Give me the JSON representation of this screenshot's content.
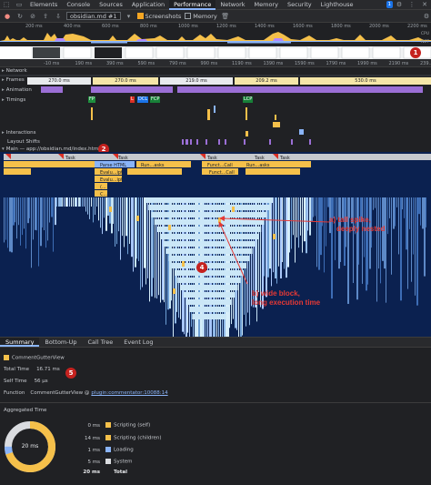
{
  "tabbar": {
    "tabs": [
      "Elements",
      "Console",
      "Sources",
      "Application",
      "Performance",
      "Network",
      "Memory",
      "Security",
      "Lighthouse"
    ],
    "active_index": 4,
    "issues_badge": "1"
  },
  "toolbar": {
    "profile_select": "obsidian.md #1",
    "screenshots_label": "Screenshots",
    "memory_label": "Memory"
  },
  "overview": {
    "ticks": [
      "200 ms",
      "400 ms",
      "600 ms",
      "800 ms",
      "1000 ms",
      "1200 ms",
      "1400 ms",
      "1600 ms",
      "1800 ms",
      "2000 ms",
      "2200 ms"
    ],
    "cpu_label": "CPU",
    "net_label": "NET"
  },
  "ruler2": {
    "ticks": [
      "-10 ms",
      "190 ms",
      "390 ms",
      "590 ms",
      "790 ms",
      "990 ms",
      "1190 ms",
      "1390 ms",
      "1590 ms",
      "1790 ms",
      "1990 ms",
      "2190 ms",
      "239..."
    ]
  },
  "ruler2_top": {
    "ticks": [
      "ms",
      "-10 ms",
      "190 ms",
      "390 ms",
      "590 ms",
      "790 ms",
      "990 ms",
      "1190 ms",
      "1390 ms",
      "1590 ms",
      "1790 ms",
      "1990 ms",
      "2190 ms"
    ]
  },
  "tracks": {
    "network": "Network",
    "frames": "Frames",
    "frame_values": [
      "270.0 ms",
      "270.0 ms",
      "219.0 ms",
      "209.2 ms",
      "530.0 ms"
    ],
    "animation": "Animation",
    "timings": "Timings",
    "timing_markers": [
      "FP",
      "L",
      "DCL",
      "FCP",
      "LCP"
    ],
    "interactions": "Interactions",
    "layout_shifts": "Layout Shifts",
    "main": "Main — app://obsidian.md/index.html"
  },
  "flame": {
    "task_labels": [
      "Task",
      "Task",
      "Task",
      "Task",
      "Task"
    ],
    "level2_labels": [
      "Parse HTML",
      "Run...asks",
      "Funct...Call",
      "Run...asks"
    ],
    "level3_labels": [
      "Evalu...ipt",
      "Evalu...ipt",
      "Funct...Call"
    ],
    "level4_labels": [
      "(...",
      "C...1"
    ],
    "level5_labels": [
      "C...1"
    ]
  },
  "annotations": {
    "a_line1": "a) tall spike,",
    "a_line2": "deeply nested",
    "b_line1": "b) wide block,",
    "b_line2": "long execution time",
    "markers": [
      "1",
      "2",
      "4",
      "5"
    ]
  },
  "bottom_tabs": [
    "Summary",
    "Bottom-Up",
    "Call Tree",
    "Event Log"
  ],
  "summary": {
    "title": "CommentGutterView",
    "total_time_label": "Total Time",
    "total_time_value": "16.71 ms",
    "self_time_label": "Self Time",
    "self_time_value": "56 μs",
    "function_label": "Function",
    "function_name": "CommentGutterView @",
    "function_link": "plugin:commentator:10088:14",
    "color": "#f5c04a"
  },
  "aggregated": {
    "title": "Aggregated Time",
    "center_label": "20 ms",
    "rows": [
      {
        "value": "0 ms",
        "name": "Scripting (self)",
        "color": "#f5c04a"
      },
      {
        "value": "14 ms",
        "name": "Scripting (children)",
        "color": "#f5c04a"
      },
      {
        "value": "1 ms",
        "name": "Loading",
        "color": "#8ab4f8"
      },
      {
        "value": "5 ms",
        "name": "System",
        "color": "#dadce0"
      },
      {
        "value": "20 ms",
        "name": "Total",
        "color": ""
      }
    ]
  }
}
